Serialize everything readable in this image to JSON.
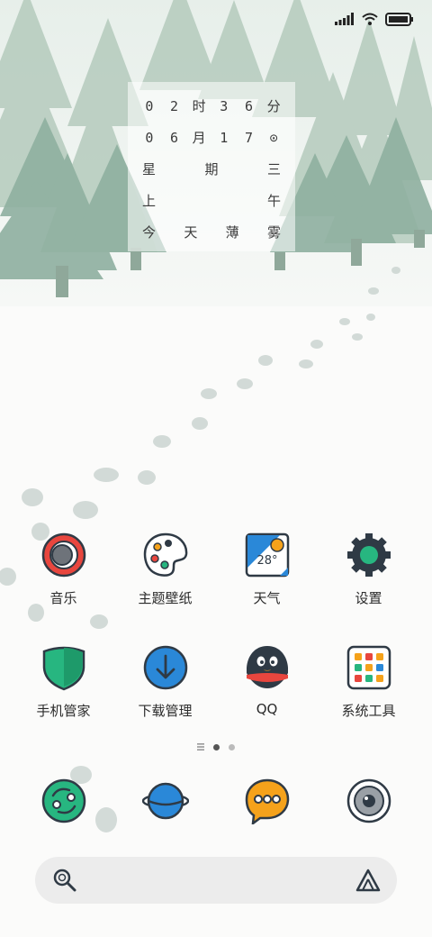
{
  "status_bar": {
    "battery_icon": "battery-icon",
    "wifi_icon": "wifi-icon",
    "signal_icon": "signal-icon"
  },
  "clock_widget": {
    "row1": [
      "0",
      "2",
      "时",
      "3",
      "6",
      "分"
    ],
    "row2": [
      "0",
      "6",
      "月",
      "1",
      "7",
      "⊙"
    ],
    "row3": [
      "星",
      "期",
      "三"
    ],
    "row4": [
      "上",
      "午"
    ],
    "row5": [
      "今",
      "天",
      "薄",
      "雾"
    ]
  },
  "apps": {
    "music": "音乐",
    "theme": "主题壁纸",
    "weather": "天气",
    "weather_temp": "28°",
    "settings": "设置",
    "security": "手机管家",
    "downloads": "下载管理",
    "qq": "QQ",
    "tools": "系统工具"
  },
  "page_indicator": {
    "pages": 3,
    "active": 1
  },
  "dock": [
    "chat-app-icon",
    "browser-icon",
    "messages-icon",
    "camera-icon"
  ],
  "search_bar": {
    "left_icon": "search-icon",
    "right_icon": "assistant-icon"
  },
  "colors": {
    "outline": "#2f3a45",
    "red": "#e8463e",
    "green": "#27b680",
    "blue": "#2a88d8",
    "orange": "#f5a21b",
    "tree": "#a9c4b6"
  }
}
